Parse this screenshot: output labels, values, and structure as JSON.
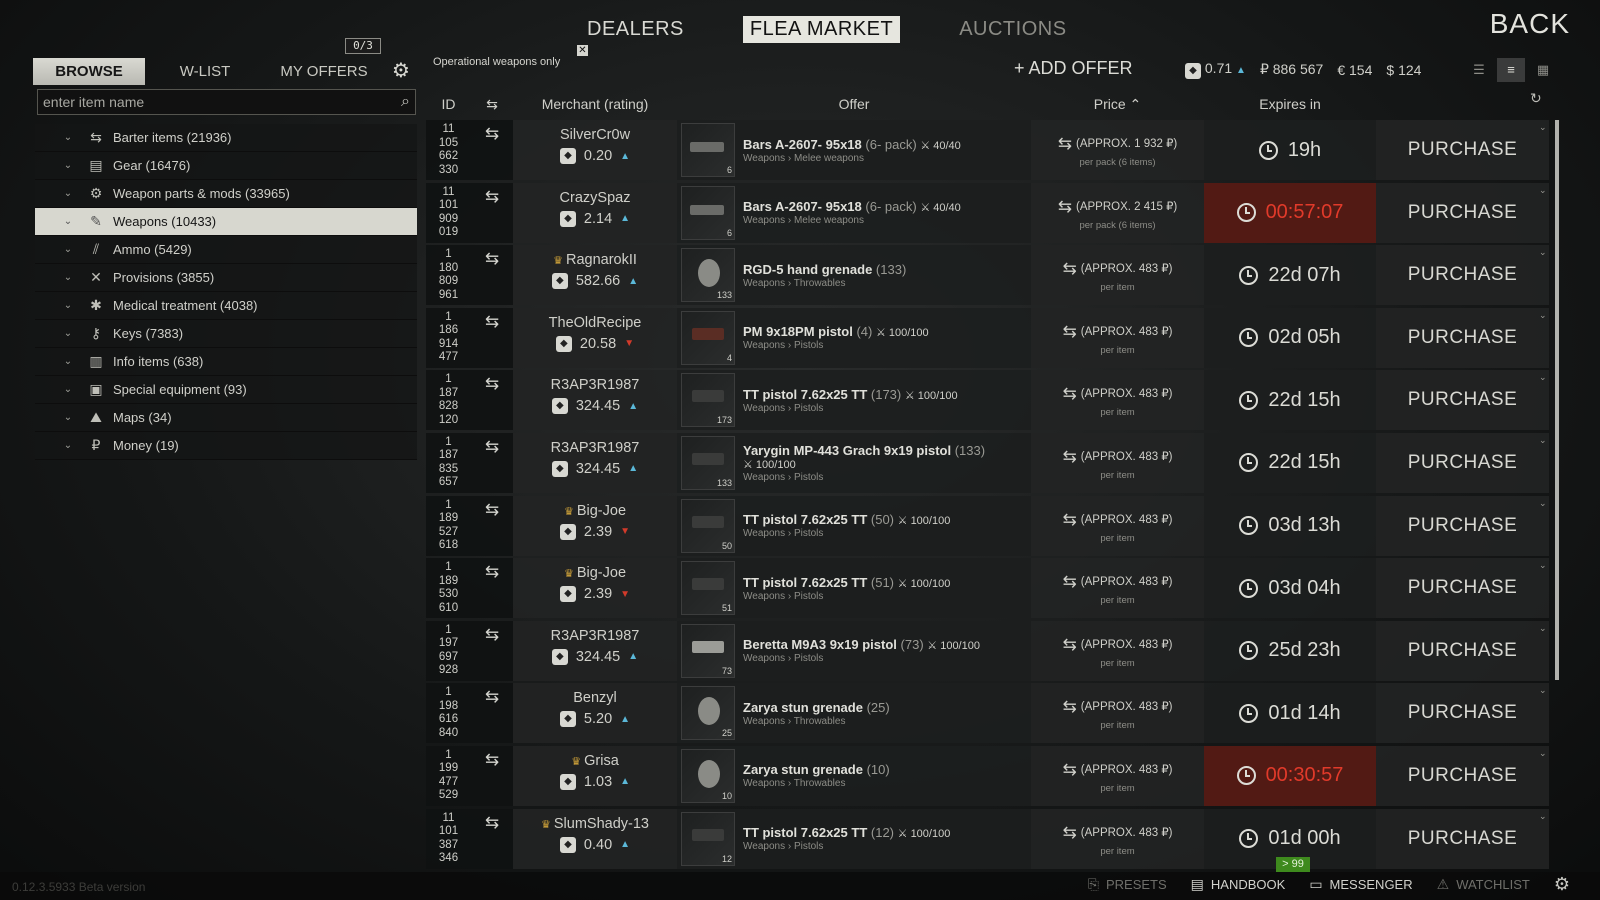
{
  "top_tabs": [
    {
      "label": "DEALERS"
    },
    {
      "label": "FLEA MARKET"
    },
    {
      "label": "AUCTIONS"
    }
  ],
  "back_label": "BACK",
  "left_tabs": {
    "browse": "BROWSE",
    "wlist": "W-LIST",
    "myoffers": "MY OFFERS"
  },
  "offer_count": "0/3",
  "search": {
    "placeholder": "enter item name"
  },
  "categories": [
    {
      "icon": "barter-icon",
      "glyph": "⇆",
      "label": "Barter items (21936)"
    },
    {
      "icon": "gear-icon",
      "glyph": "▤",
      "label": "Gear (16476)"
    },
    {
      "icon": "weapon-parts-icon",
      "glyph": "⚙",
      "label": "Weapon parts & mods (33965)"
    },
    {
      "icon": "weapons-icon",
      "glyph": "✎",
      "label": "Weapons (10433)"
    },
    {
      "icon": "ammo-icon",
      "glyph": "⫽",
      "label": "Ammo (5429)"
    },
    {
      "icon": "provisions-icon",
      "glyph": "✕",
      "label": "Provisions (3855)"
    },
    {
      "icon": "medical-icon",
      "glyph": "✱",
      "label": "Medical treatment (4038)"
    },
    {
      "icon": "keys-icon",
      "glyph": "⚷",
      "label": "Keys (7383)"
    },
    {
      "icon": "info-icon",
      "glyph": "▥",
      "label": "Info items (638)"
    },
    {
      "icon": "special-equipment-icon",
      "glyph": "▣",
      "label": "Special equipment (93)"
    },
    {
      "icon": "maps-icon",
      "glyph": "⛰",
      "label": "Maps (34)"
    },
    {
      "icon": "money-icon",
      "glyph": "₽",
      "label": "Money (19)"
    }
  ],
  "filter_chip": "Operational weapons only",
  "add_offer": "+ ADD OFFER",
  "currency": {
    "rep": "0.71",
    "rub": "₽ 886 567",
    "eur": "€ 154",
    "usd": "$ 124"
  },
  "table_headers": {
    "id": "ID",
    "merchant": "Merchant (rating)",
    "offer": "Offer",
    "price": "Price ⌃",
    "expires": "Expires in"
  },
  "rows": [
    {
      "id": [
        "11",
        "105",
        "662",
        "330"
      ],
      "crown": false,
      "merchant": "SilverCr0w",
      "rating": "0.20",
      "trend": "up",
      "item": "Bars A-2607- 95x18",
      "count": "(6- pack)",
      "dur": "40/40",
      "dur_inline": true,
      "category": "Weapons › Melee weapons",
      "qty": "6",
      "thumb": "knife",
      "price": "(APPROX. 1 932 ₽)",
      "price_sub": "per pack (6 items)",
      "expires": "19h",
      "urgent": false,
      "buy": "PURCHASE"
    },
    {
      "id": [
        "11",
        "101",
        "909",
        "019"
      ],
      "crown": false,
      "merchant": "CrazySpaz",
      "rating": "2.14",
      "trend": "up",
      "item": "Bars A-2607- 95x18",
      "count": "(6- pack)",
      "dur": "40/40",
      "dur_inline": true,
      "category": "Weapons › Melee weapons",
      "qty": "6",
      "thumb": "knife",
      "price": "(APPROX. 2 415 ₽)",
      "price_sub": "per pack (6 items)",
      "expires": "00:57:07",
      "urgent": true,
      "buy": "PURCHASE"
    },
    {
      "id": [
        "1",
        "180",
        "809",
        "961"
      ],
      "crown": true,
      "merchant": "RagnarokII",
      "rating": "582.66",
      "trend": "up",
      "item": "RGD-5 hand grenade",
      "count": "(133)",
      "dur": "",
      "dur_inline": true,
      "category": "Weapons › Throwables",
      "qty": "133",
      "thumb": "grenade",
      "price": "(APPROX. 483 ₽)",
      "price_sub": "per item",
      "expires": "22d 07h",
      "urgent": false,
      "buy": "PURCHASE"
    },
    {
      "id": [
        "1",
        "186",
        "914",
        "477"
      ],
      "crown": false,
      "merchant": "TheOldRecipe",
      "rating": "20.58",
      "trend": "down",
      "item": "PM 9x18PM pistol",
      "count": "(4)",
      "dur": "100/100",
      "dur_inline": true,
      "category": "Weapons › Pistols",
      "qty": "4",
      "thumb": "pistol-red",
      "price": "(APPROX. 483 ₽)",
      "price_sub": "per item",
      "expires": "02d 05h",
      "urgent": false,
      "buy": "PURCHASE"
    },
    {
      "id": [
        "1",
        "187",
        "828",
        "120"
      ],
      "crown": false,
      "merchant": "R3AP3R1987",
      "rating": "324.45",
      "trend": "up",
      "item": "TT pistol 7.62x25 TT",
      "count": "(173)",
      "dur": "100/100",
      "dur_inline": true,
      "category": "Weapons › Pistols",
      "qty": "173",
      "thumb": "pistol",
      "price": "(APPROX. 483 ₽)",
      "price_sub": "per item",
      "expires": "22d 15h",
      "urgent": false,
      "buy": "PURCHASE"
    },
    {
      "id": [
        "1",
        "187",
        "835",
        "657"
      ],
      "crown": false,
      "merchant": "R3AP3R1987",
      "rating": "324.45",
      "trend": "up",
      "item": "Yarygin MP-443 Grach 9x19 pistol",
      "count": "(133)",
      "dur": "100/100",
      "dur_inline": false,
      "category": "Weapons › Pistols",
      "qty": "133",
      "thumb": "pistol",
      "price": "(APPROX. 483 ₽)",
      "price_sub": "per item",
      "expires": "22d 15h",
      "urgent": false,
      "buy": "PURCHASE"
    },
    {
      "id": [
        "1",
        "189",
        "527",
        "618"
      ],
      "crown": true,
      "merchant": "Big-Joe",
      "rating": "2.39",
      "trend": "down",
      "item": "TT pistol 7.62x25 TT",
      "count": "(50)",
      "dur": "100/100",
      "dur_inline": true,
      "category": "Weapons › Pistols",
      "qty": "50",
      "thumb": "pistol",
      "price": "(APPROX. 483 ₽)",
      "price_sub": "per item",
      "expires": "03d 13h",
      "urgent": false,
      "buy": "PURCHASE"
    },
    {
      "id": [
        "1",
        "189",
        "530",
        "610"
      ],
      "crown": true,
      "merchant": "Big-Joe",
      "rating": "2.39",
      "trend": "down",
      "item": "TT pistol 7.62x25 TT",
      "count": "(51)",
      "dur": "100/100",
      "dur_inline": true,
      "category": "Weapons › Pistols",
      "qty": "51",
      "thumb": "pistol",
      "price": "(APPROX. 483 ₽)",
      "price_sub": "per item",
      "expires": "03d 04h",
      "urgent": false,
      "buy": "PURCHASE"
    },
    {
      "id": [
        "1",
        "197",
        "697",
        "928"
      ],
      "crown": false,
      "merchant": "R3AP3R1987",
      "rating": "324.45",
      "trend": "up",
      "item": "Beretta M9A3 9x19 pistol",
      "count": "(73)",
      "dur": "100/100",
      "dur_inline": true,
      "category": "Weapons › Pistols",
      "qty": "73",
      "thumb": "beretta",
      "price": "(APPROX. 483 ₽)",
      "price_sub": "per item",
      "expires": "25d 23h",
      "urgent": false,
      "buy": "PURCHASE"
    },
    {
      "id": [
        "1",
        "198",
        "616",
        "840"
      ],
      "crown": false,
      "merchant": "Benzyl",
      "rating": "5.20",
      "trend": "up",
      "item": "Zarya stun grenade",
      "count": "(25)",
      "dur": "",
      "dur_inline": true,
      "category": "Weapons › Throwables",
      "qty": "25",
      "thumb": "grenade",
      "price": "(APPROX. 483 ₽)",
      "price_sub": "per item",
      "expires": "01d 14h",
      "urgent": false,
      "buy": "PURCHASE"
    },
    {
      "id": [
        "1",
        "199",
        "477",
        "529"
      ],
      "crown": true,
      "merchant": "Grisa",
      "rating": "1.03",
      "trend": "up",
      "item": "Zarya stun grenade",
      "count": "(10)",
      "dur": "",
      "dur_inline": true,
      "category": "Weapons › Throwables",
      "qty": "10",
      "thumb": "grenade",
      "price": "(APPROX. 483 ₽)",
      "price_sub": "per item",
      "expires": "00:30:57",
      "urgent": true,
      "buy": "PURCHASE"
    },
    {
      "id": [
        "11",
        "101",
        "387",
        "346"
      ],
      "crown": true,
      "merchant": "SlumShady-13",
      "rating": "0.40",
      "trend": "up",
      "item": "TT pistol 7.62x25 TT",
      "count": "(12)",
      "dur": "100/100",
      "dur_inline": true,
      "category": "Weapons › Pistols",
      "qty": "12",
      "thumb": "pistol",
      "price": "(APPROX. 483 ₽)",
      "price_sub": "per item",
      "expires": "01d 00h",
      "urgent": false,
      "buy": "PURCHASE"
    }
  ],
  "badge_99": "> 99",
  "bottom_nav": [
    {
      "label": "PRESETS",
      "icon": "presets-icon",
      "glyph": "⎘",
      "dim": true
    },
    {
      "label": "HANDBOOK",
      "icon": "handbook-icon",
      "glyph": "▤",
      "dim": false
    },
    {
      "label": "MESSENGER",
      "icon": "messenger-icon",
      "glyph": "▭",
      "dim": false
    },
    {
      "label": "WATCHLIST",
      "icon": "watchlist-icon",
      "glyph": "⚠",
      "dim": true
    }
  ],
  "version": "0.12.3.5933 Beta version"
}
